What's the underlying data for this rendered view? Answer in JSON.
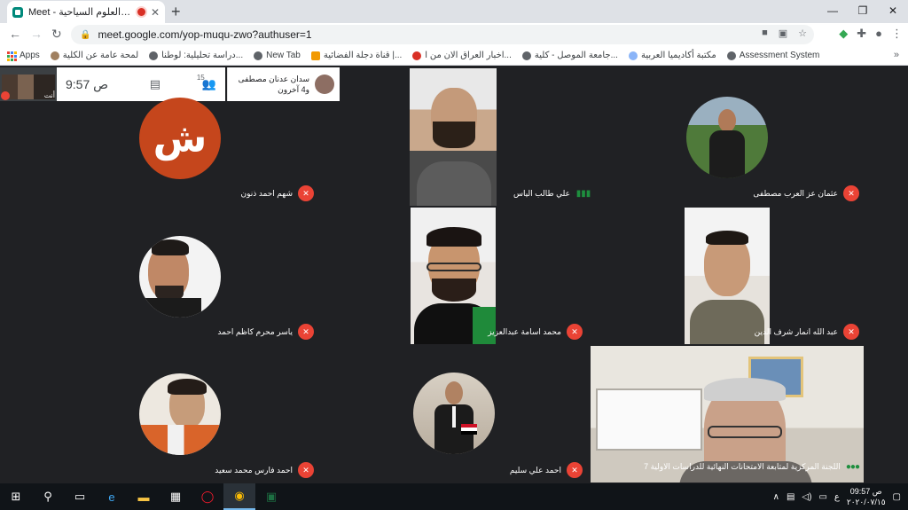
{
  "browser": {
    "tab_title": "Meet - كلية العلوم السياحية /",
    "tab_close": "✕",
    "new_tab": "+",
    "window_controls": [
      "—",
      "❐",
      "✕"
    ],
    "url": "meet.google.com/yop-muqu-zwo?authuser=1"
  },
  "bookmarks": [
    {
      "label": "Apps"
    },
    {
      "label": "لمحة عامة عن الكلية"
    },
    {
      "label": "دراسة تحليلية: لوطنا..."
    },
    {
      "label": "New Tab"
    },
    {
      "label": "قناة دجلة الفضائية |..."
    },
    {
      "label": "اخبار العراق الان من ا..."
    },
    {
      "label": "جامعة الموصل - كلية..."
    },
    {
      "label": "مكتبة أكاديميا العربية"
    },
    {
      "label": "Assessment System"
    }
  ],
  "meet": {
    "self_label": "أنت",
    "participant_count": "15",
    "clock": "9:57 ص",
    "presenter_line1": "سدان عدنان مصطفى",
    "presenter_line2": "و4 آخرون"
  },
  "participants": [
    {
      "name": "شهم احمد ذنون",
      "avatar_letter": "ش",
      "mic": "muted"
    },
    {
      "name": "علي طالب الياس",
      "mic": "speaking"
    },
    {
      "name": "عثمان عز العرب مصطفى",
      "mic": "muted"
    },
    {
      "name": "ياسر محرم كاظم احمد",
      "mic": "muted"
    },
    {
      "name": "محمد اسامة عبدالعزيز",
      "mic": "muted"
    },
    {
      "name": "عبد الله انمار شرف الدين",
      "mic": "muted"
    },
    {
      "name": "احمد فارس محمد سعيد",
      "mic": "muted"
    },
    {
      "name": "احمد علي سليم",
      "mic": "muted"
    },
    {
      "name": "اللجنة المركزية لمتابعة الامتحانات النهائية للدراسات الاولية 7",
      "mic": "active"
    }
  ],
  "taskbar": {
    "time": "09:57 ص",
    "date": "٢٠٢٠/٠٧/١٥",
    "lang": "ع"
  },
  "colors": {
    "meet_bg": "#202124",
    "mute_red": "#ea4335",
    "letter_avatar": "#c5461c",
    "speaking_green": "#1e8e3e"
  }
}
